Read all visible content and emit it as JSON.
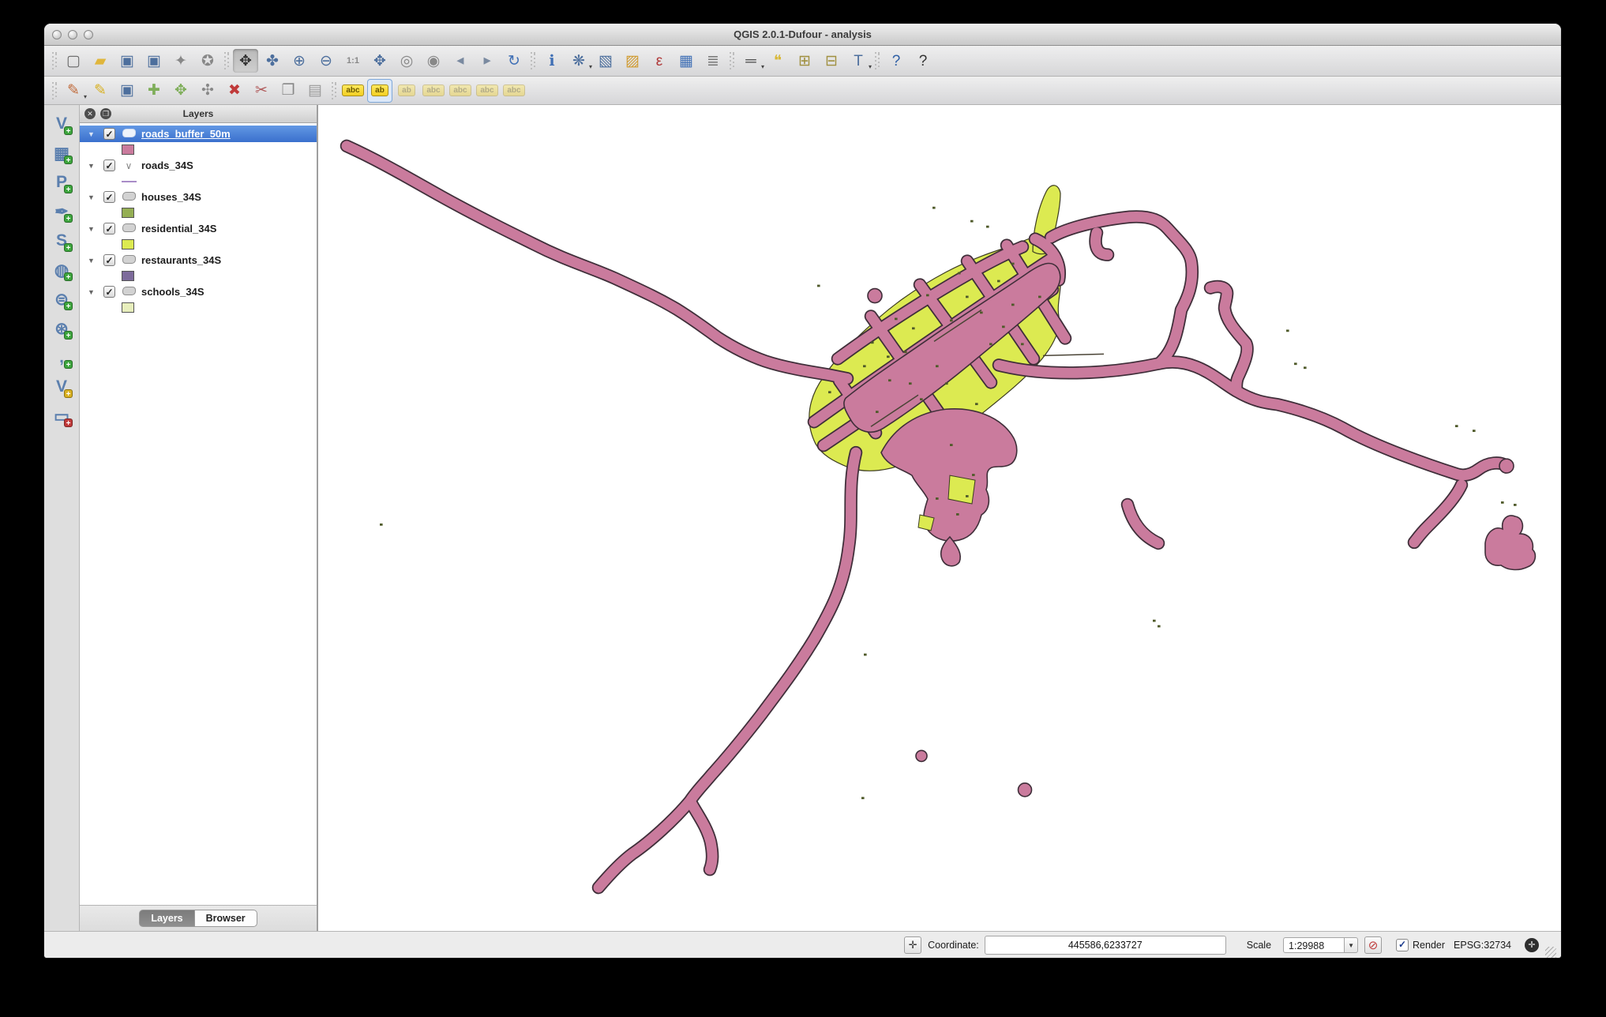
{
  "window": {
    "title": "QGIS 2.0.1-Dufour - analysis"
  },
  "colors": {
    "buffer_fill": "#ca7b9d",
    "buffer_outline": "#3f2e39",
    "residential_fill": "#dcea51",
    "residential_outline": "#3c3c20",
    "houses_fill": "#94ae53",
    "houses_dark": "#4f5a2a",
    "restaurants_fill": "#7d6b9b",
    "schools_fill": "#e7eebc",
    "roads_line": "#a98cc8",
    "selection_blue": "#3a70cd",
    "map_background": "#ffffff"
  },
  "toolbar_main": [
    {
      "name": "new-project",
      "glyph": "▢",
      "color": "#666"
    },
    {
      "name": "open-project",
      "glyph": "▰",
      "color": "#e0b63c"
    },
    {
      "name": "save-project",
      "glyph": "▣",
      "color": "#4d6f9d"
    },
    {
      "name": "save-project-as",
      "glyph": "▣",
      "color": "#4d6f9d"
    },
    {
      "name": "new-print-composer",
      "glyph": "✦",
      "color": "#888"
    },
    {
      "name": "composer-manager",
      "glyph": "✪",
      "color": "#888"
    },
    {
      "sep": true
    },
    {
      "name": "pan-map",
      "glyph": "✥",
      "color": "#333",
      "active": true
    },
    {
      "name": "pan-to-selection",
      "glyph": "✤",
      "color": "#4d6f9d"
    },
    {
      "name": "zoom-in",
      "glyph": "⊕",
      "color": "#4d6f9d"
    },
    {
      "name": "zoom-out",
      "glyph": "⊖",
      "color": "#4d6f9d"
    },
    {
      "name": "zoom-actual-size",
      "glyph": "1:1",
      "color": "#888",
      "small": true
    },
    {
      "name": "zoom-full",
      "glyph": "✥",
      "color": "#4d6f9d"
    },
    {
      "name": "zoom-to-selection",
      "glyph": "◎",
      "color": "#888"
    },
    {
      "name": "zoom-to-layer",
      "glyph": "◉",
      "color": "#888"
    },
    {
      "name": "zoom-last",
      "glyph": "◀",
      "color": "#7a8aa0",
      "small": true
    },
    {
      "name": "zoom-next",
      "glyph": "▶",
      "color": "#7a8aa0",
      "small": true
    },
    {
      "name": "refresh",
      "glyph": "↻",
      "color": "#3f6fb5"
    },
    {
      "sep": true
    },
    {
      "name": "identify-features",
      "glyph": "ℹ",
      "color": "#3f6fb5"
    },
    {
      "name": "run-feature-action",
      "glyph": "❋",
      "color": "#4d6f9d",
      "dd": true
    },
    {
      "name": "select-features",
      "glyph": "▧",
      "color": "#d8b javais"
    },
    {
      "name": "deselect-features",
      "glyph": "▨",
      "color": "#d09a2e"
    },
    {
      "name": "select-by-expression",
      "glyph": "ε",
      "color": "#b03a3a"
    },
    {
      "name": "open-attribute-table",
      "glyph": "▦",
      "color": "#3f6fb5"
    },
    {
      "name": "field-calculator",
      "glyph": "≣",
      "color": "#777"
    },
    {
      "sep": true
    },
    {
      "name": "measure-line",
      "glyph": "═",
      "color": "#555",
      "dd": true
    },
    {
      "name": "map-tips",
      "glyph": "❝",
      "color": "#d8b838"
    },
    {
      "name": "new-bookmark",
      "glyph": "⊞",
      "color": "#a09040"
    },
    {
      "name": "show-bookmarks",
      "glyph": "⊟",
      "color": "#a09040"
    },
    {
      "name": "text-annotation",
      "glyph": "T",
      "color": "#4d6f9d",
      "dd": true
    },
    {
      "sep": true
    },
    {
      "name": "help-contents",
      "glyph": "?",
      "color": "#2e5fa5"
    },
    {
      "name": "whats-this",
      "glyph": "?",
      "color": "#333"
    }
  ],
  "toolbar_edit": [
    {
      "name": "current-edits",
      "glyph": "✎",
      "color": "#c06a3a",
      "dd": true
    },
    {
      "name": "toggle-editing",
      "glyph": "✎",
      "color": "#d8b020"
    },
    {
      "name": "save-layer-edits",
      "glyph": "▣",
      "color": "#4d6f9d"
    },
    {
      "name": "add-feature",
      "glyph": "✚",
      "color": "#7fae5a"
    },
    {
      "name": "move-feature",
      "glyph": "✥",
      "color": "#7fae5a"
    },
    {
      "name": "node-tool",
      "glyph": "✣",
      "color": "#888"
    },
    {
      "name": "delete-selected",
      "glyph": "✖",
      "color": "#c03a3a"
    },
    {
      "name": "cut-features",
      "glyph": "✂",
      "color": "#b05a5a"
    },
    {
      "name": "copy-features",
      "glyph": "❐",
      "color": "#888"
    },
    {
      "name": "paste-features",
      "glyph": "▤",
      "color": "#999"
    },
    {
      "sep": true
    },
    {
      "name": "labeling-options",
      "tag": "abc"
    },
    {
      "name": "pin-unpin-labels",
      "tag": "ab",
      "selectedBtn": true
    },
    {
      "name": "highlight-pinned-labels",
      "tag": "ab",
      "disabled": true
    },
    {
      "name": "move-label",
      "tag": "abc",
      "disabled": true
    },
    {
      "name": "rotate-label",
      "tag": "abc",
      "disabled": true
    },
    {
      "name": "change-label-properties",
      "tag": "abc",
      "disabled": true
    },
    {
      "name": "label-properties",
      "tag": "abc",
      "disabled": true
    }
  ],
  "toolbar_layers": [
    {
      "name": "add-vector-layer",
      "glyph": "V",
      "badge": "#3da53d"
    },
    {
      "name": "add-raster-layer",
      "glyph": "▦",
      "badge": "#3da53d"
    },
    {
      "name": "add-postgis-layer",
      "glyph": "P",
      "badge": "#3da53d"
    },
    {
      "name": "add-spatialite-layer",
      "glyph": "✒",
      "badge": "#3da53d"
    },
    {
      "name": "add-mssql-layer",
      "glyph": "S",
      "badge": "#3da53d"
    },
    {
      "name": "add-wms-layer",
      "glyph": "◍",
      "badge": "#3da53d"
    },
    {
      "name": "add-wcs-layer",
      "glyph": "⊜",
      "badge": "#3da53d"
    },
    {
      "name": "add-wfs-layer",
      "glyph": "⊛",
      "badge": "#3da53d"
    },
    {
      "name": "add-delimited-text-layer",
      "glyph": ",",
      "badge": "#3da53d"
    },
    {
      "name": "new-shapefile-layer",
      "glyph": "V",
      "badge": "#d8b020"
    },
    {
      "name": "remove-layer",
      "glyph": "▭",
      "badge": "#c03a3a"
    }
  ],
  "layers_panel": {
    "title": "Layers",
    "tabs": [
      {
        "label": "Layers",
        "active": true
      },
      {
        "label": "Browser",
        "active": false
      }
    ],
    "layers": [
      {
        "name": "roads_buffer_50m",
        "type": "polygon",
        "selected": true,
        "checked": true,
        "swatch": "#ca7b9d"
      },
      {
        "name": "roads_34S",
        "type": "line",
        "selected": false,
        "checked": true,
        "swatch": "#a98cc8"
      },
      {
        "name": "houses_34S",
        "type": "polygon",
        "selected": false,
        "checked": true,
        "swatch": "#94ae53"
      },
      {
        "name": "residential_34S",
        "type": "polygon",
        "selected": false,
        "checked": true,
        "swatch": "#dcea51"
      },
      {
        "name": "restaurants_34S",
        "type": "polygon",
        "selected": false,
        "checked": true,
        "swatch": "#7d6b9b"
      },
      {
        "name": "schools_34S",
        "type": "polygon",
        "selected": false,
        "checked": true,
        "swatch": "#e7eebc"
      }
    ]
  },
  "statusbar": {
    "coordinate_label": "Coordinate:",
    "coordinate_value": "445586,6233727",
    "scale_label": "Scale",
    "scale_value": "1:29988",
    "render_label": "Render",
    "render_checked": true,
    "crs": "EPSG:32734"
  }
}
